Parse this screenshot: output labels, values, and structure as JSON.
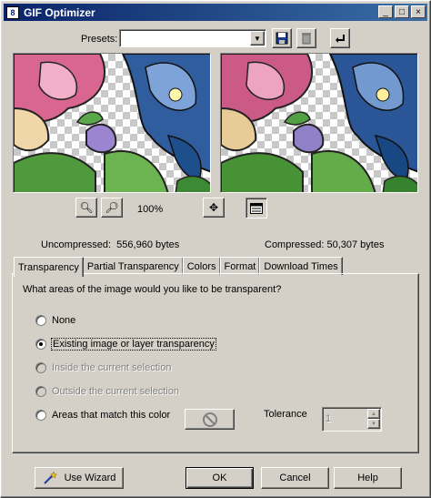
{
  "window": {
    "title": "GIF Optimizer",
    "app_icon_glyph": "8",
    "controls": {
      "minimize": "_",
      "maximize": "□",
      "close": "×"
    }
  },
  "presets": {
    "label": "Presets:",
    "value": "",
    "save_icon": "floppy-disk-icon",
    "delete_icon": "trash-icon",
    "reset_icon": "undo-arrow-icon"
  },
  "preview": {
    "zoom_label": "100%",
    "uncompressed_label": "Uncompressed:",
    "uncompressed_value": "556,960 bytes",
    "compressed_label": "Compressed:",
    "compressed_value": "50,307 bytes"
  },
  "tabs": [
    {
      "label": "Transparency",
      "active": true
    },
    {
      "label": "Partial Transparency",
      "active": false
    },
    {
      "label": "Colors",
      "active": false
    },
    {
      "label": "Format",
      "active": false
    },
    {
      "label": "Download Times",
      "active": false
    }
  ],
  "transparency": {
    "question": "What areas of the image would you like to be transparent?",
    "options": [
      {
        "label": "None",
        "checked": false,
        "enabled": true
      },
      {
        "label": "Existing image or layer transparency",
        "checked": true,
        "enabled": true
      },
      {
        "label": "Inside the current selection",
        "checked": false,
        "enabled": false
      },
      {
        "label": "Outside the current selection",
        "checked": false,
        "enabled": false
      },
      {
        "label": "Areas that match this color",
        "checked": false,
        "enabled": true
      }
    ],
    "tolerance_label": "Tolerance",
    "tolerance_value": "1"
  },
  "buttons": {
    "wizard": "Use Wizard",
    "ok": "OK",
    "cancel": "Cancel",
    "help": "Help"
  }
}
